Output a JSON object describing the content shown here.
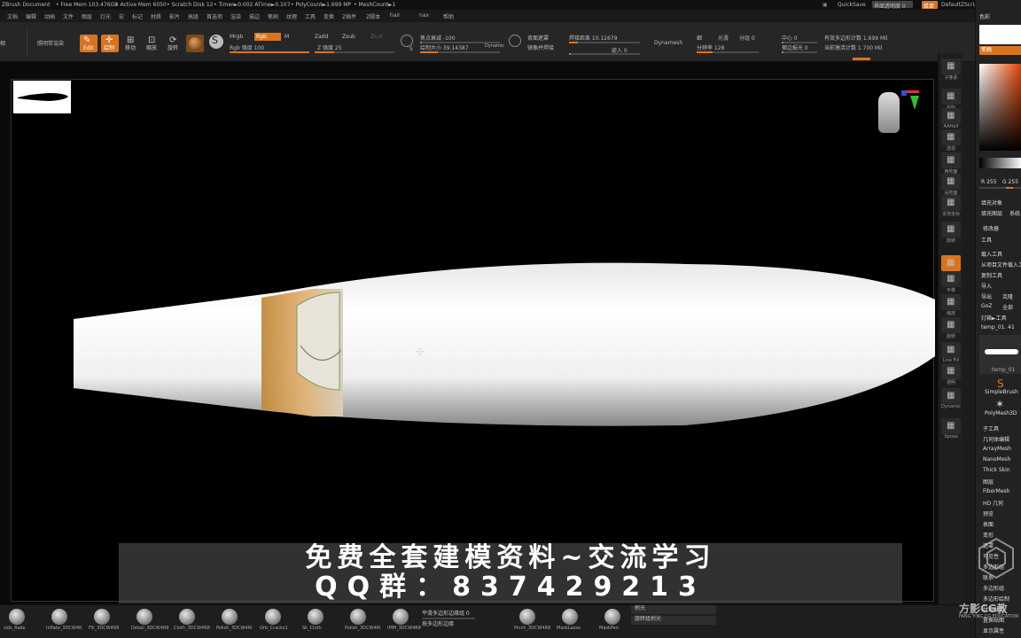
{
  "titlebar": {
    "doc": "ZBrush Document",
    "free_mem": "• Free Mem 103.476GB",
    "active_mem": "• Active Mem 6050",
    "scratch": "• Scratch Disk 12",
    "timer": "• Timer►0.002 ATime►0.107",
    "polycount": "• PolyCount►1.699 MP",
    "meshcount": "• MeshCount►1",
    "quicksave": "QuickSave",
    "ui_transparency": "界面透明度 0",
    "menu_btn": "菜单",
    "script": "DefaultZScript"
  },
  "menu": [
    "文档",
    "编辑",
    "动画",
    "文件",
    "图层",
    "灯光",
    "宏",
    "标记",
    "材质",
    "影片",
    "高级",
    "首选项",
    "渲染",
    "描边",
    "笔刷",
    "纹理",
    "工具",
    "变换",
    "Z插件",
    "Z脚本",
    "hair",
    "nax",
    "帮助"
  ],
  "toolbar": {
    "left_label": "投影大师",
    "lightbox": "照明带渲染",
    "edit": "Edit",
    "draw": "绘制",
    "move": "移动",
    "scale": "缩放",
    "rotate": "旋转",
    "mrgb": "Mrgb",
    "rgb": "Rgb",
    "m": "M",
    "rgb_intensity": "Rgb 强度 100",
    "zadd": "Zadd",
    "zsub": "Zsub",
    "zcut": "Zcut",
    "z_intensity": "Z 强度 25",
    "focal_shift": "焦点衰减 -100",
    "draw_size": "绘制大小 39.14387",
    "dynamic": "Dynamic",
    "backface_mask": "背面遮罩",
    "mirror_weld": "镜像并焊接",
    "weld_distance": "焊接距离 10.12679",
    "weld_dist_max": "嵌入 0",
    "dynamesh": "Dynamesh",
    "resolution_label": "分辨率 128",
    "smooth": "光滑",
    "subdiv": "分组 0",
    "center": "中心 0",
    "polish": "梱边报光 0",
    "total_points": "有效多边形计数 1.699 Mil",
    "active_points": "当前激活计数 1.700 Mil",
    "s_label": "S"
  },
  "shelf": [
    "子像素",
    "实际",
    "AAHalf",
    "透视",
    "两地面",
    "设地面",
    "本地坐标",
    "旋转",
    "Qxyz",
    "平移",
    "缩放",
    "旋转",
    "Line Fill",
    "透明",
    "Dynamic",
    "Xpose"
  ],
  "palette": {
    "header": "色彩",
    "swatch_btn": "笔触",
    "rgb_r": "R 255",
    "rgb_g": "G 255",
    "fill_object": "填充对象",
    "fill_layer": "填充图层",
    "system": "系统",
    "modifier": "修改器",
    "tool_header": "工具",
    "load_tool": "载入工具",
    "load_from_project": "从项目文件载入工具",
    "copy_tool": "复制工具",
    "import": "导入",
    "export": "导出",
    "clone": "克隆",
    "goz": "GoZ",
    "all": "全部",
    "lightbox_tools": "灯箱►工具",
    "tool_name": "temp_01. 41",
    "thumb_label": "temp_01",
    "simplebrush": "SimpleBrush",
    "polymesh": "PolyMesh3D",
    "subtool": "子工具",
    "geometry": "几何体编辑",
    "arraymesh": "ArrayMesh",
    "nanomesh": "NanoMesh",
    "thickskin": "Thick Skin",
    "layers": "图层",
    "fibermesh": "FiberMesh",
    "hd": "HD 几何",
    "preview": "预览",
    "surface": "表面",
    "deform": "变形",
    "masking": "遮罩",
    "visibility": "可见性",
    "polygroups": "多边形组",
    "contact": "联系",
    "morph": "多边形组",
    "uvmap": "多边形绘制",
    "texture": "纹理贴图",
    "displacement": "置换贴图",
    "display": "显示属性"
  },
  "bottom": {
    "brushes": [
      "sids_Rake",
      "Inflate_3DCW4R",
      "Fill_3DCW4R8",
      "Detail_3DCW4R8",
      "Cloth_3DCW4R8",
      "Polish_3DCW4RI",
      "Orb_Cracks1",
      "Sk_Cloth",
      "Polish_3DCW4RI",
      "IMM_3DCW4R8",
      "Pinch_3DCW4R8",
      "MaskLasso",
      "MaskPen"
    ],
    "smooth_groups": "平滑多边形边缘组 0",
    "smooth_label": "拊光",
    "rotate_label": "旋转组拊光",
    "poly_note": "按多边形边缘"
  },
  "banner": {
    "line1": "免费全套建模资料~交流学习",
    "line2": "QQ群：837429213"
  },
  "watermark": {
    "logo_text": "方影CG教",
    "logo_sub": "FANG YING CG EDUCATION"
  },
  "colors": {
    "accent": "#d87420",
    "model_body": "#f5f5f5",
    "canvas_bg": "#000000"
  }
}
